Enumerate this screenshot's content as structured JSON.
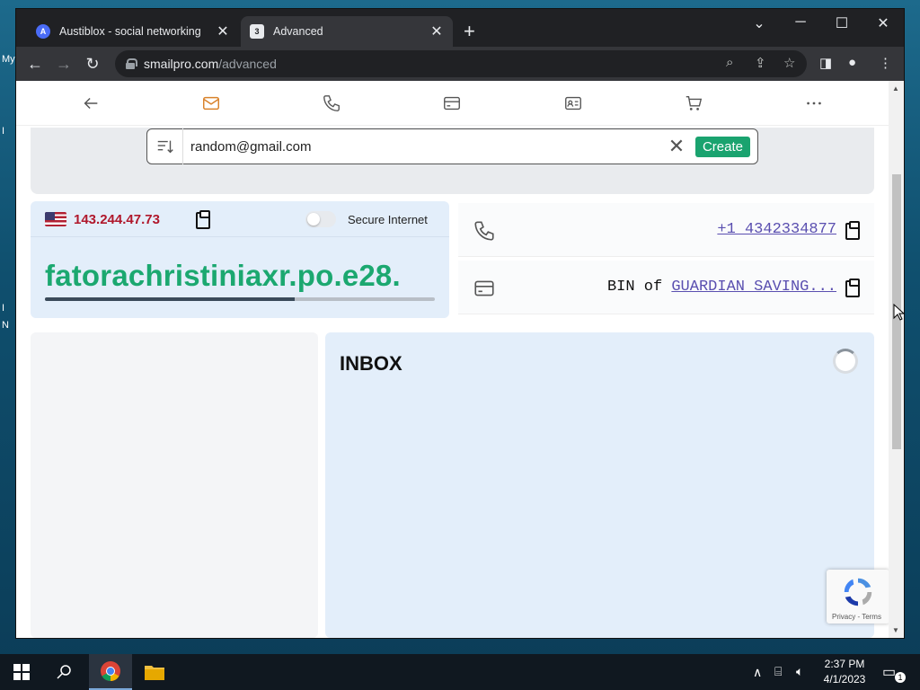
{
  "desktop": {
    "fragments": [
      "My",
      "I",
      "I",
      "N"
    ]
  },
  "browser": {
    "tabs": [
      {
        "title": "Austiblox - social networking",
        "favicon": "A",
        "active": false
      },
      {
        "title": "Advanced",
        "favicon": "3",
        "active": true
      }
    ],
    "url_host": "smailpro.com",
    "url_path": "/advanced"
  },
  "app": {
    "nav_icons": [
      "back-arrow-icon",
      "mail-icon",
      "phone-icon",
      "credit-card-icon",
      "id-card-icon",
      "cart-icon",
      "more-icon"
    ],
    "email_input_value": "random@gmail.com",
    "create_label": "Create",
    "ip": "143.244.47.73",
    "secure_label": "Secure Internet",
    "generated_email": "fatorachristiniaxr.po.e28.",
    "email_progress": 0.64,
    "phone": "+1 4342334877",
    "bin_prefix": "BIN of ",
    "bin_link": "GUARDIAN SAVING...",
    "inbox_title": "INBOX",
    "recaptcha_text": "Privacy - Terms"
  },
  "taskbar": {
    "time": "2:37 PM",
    "date": "4/1/2023",
    "notification_count": "1"
  },
  "colors": {
    "accent_green": "#1aa36f",
    "ip_red": "#b0182c",
    "link_purple": "#5a4fb0",
    "mail_orange": "#d9822b"
  }
}
